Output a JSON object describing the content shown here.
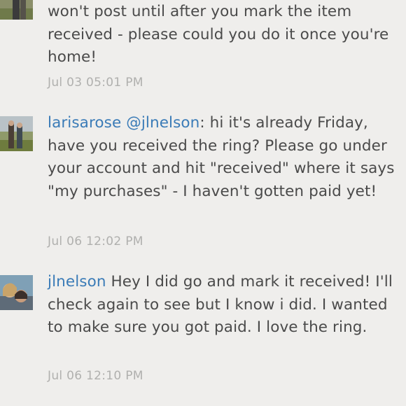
{
  "comments": [
    {
      "username": "",
      "mention": "",
      "text": "won't post until after you mark the item received - please could you do it once you're home!",
      "timestamp": "Jul 03 05:01 PM"
    },
    {
      "username": "larisarose",
      "mention": "@jlnelson",
      "text": ": hi it's already Friday, have you received the ring? Please go under your account and hit \"received\" where it says \"my purchases\" - I haven't gotten paid yet!",
      "timestamp": "Jul 06 12:02 PM"
    },
    {
      "username": "jlnelson",
      "mention": "",
      "text": "Hey I did go and mark it received! I'll check again to see but I know i did. I wanted to make sure you got paid.  I love the ring.",
      "timestamp": "Jul 06 12:10 PM"
    }
  ]
}
